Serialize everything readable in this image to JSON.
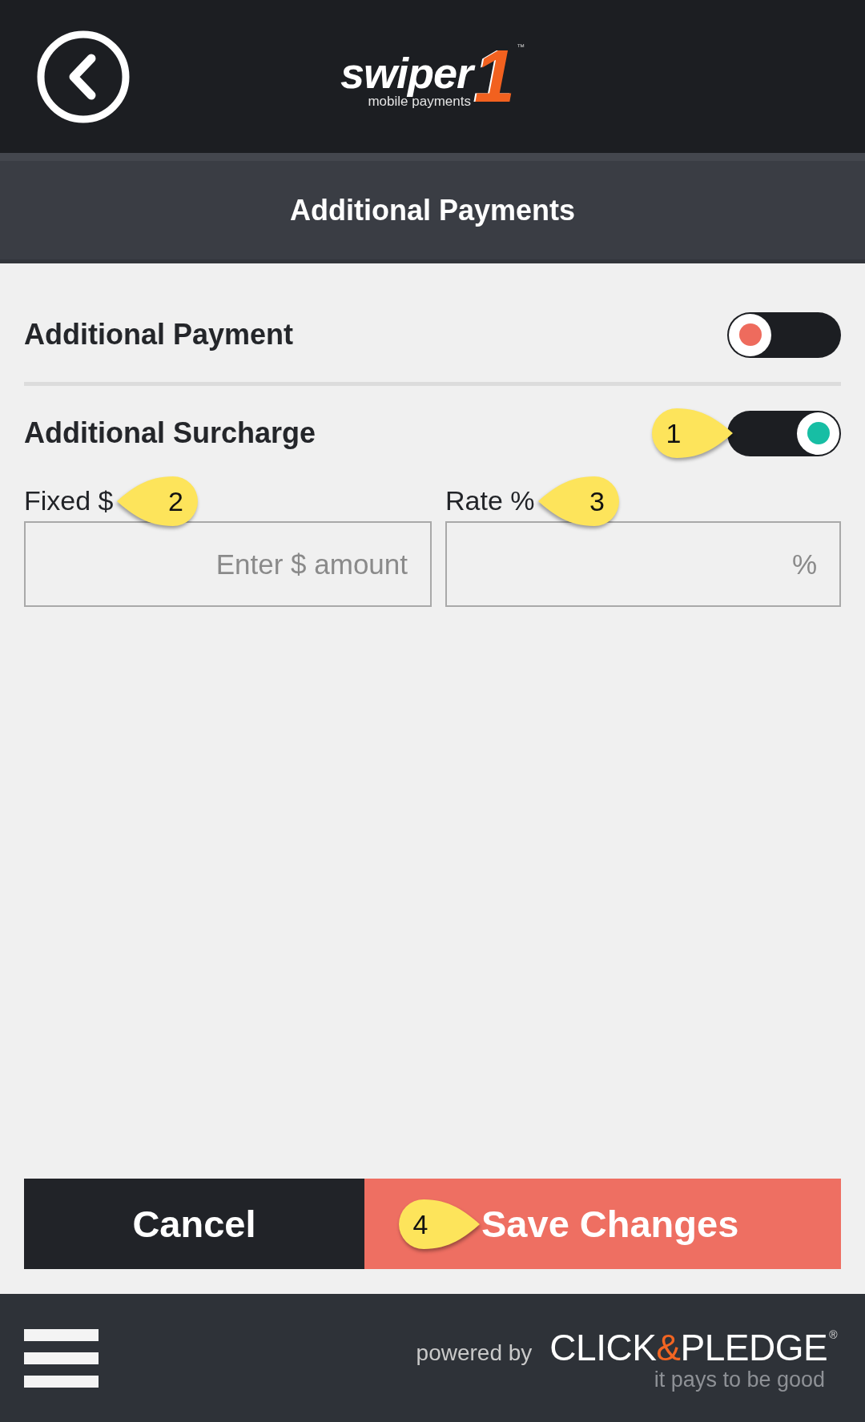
{
  "logo": {
    "wordmark": "swiper",
    "numeral": "1",
    "tagline": "mobile payments",
    "trademark": "™"
  },
  "title_bar": {
    "title": "Additional Payments"
  },
  "settings": [
    {
      "label": "Additional Payment",
      "on": false
    },
    {
      "label": "Additional Surcharge",
      "on": true,
      "callout": {
        "number": "1",
        "kind": "rightward"
      }
    }
  ],
  "fields": [
    {
      "label": "Fixed $",
      "placeholder": "Enter $ amount",
      "callout": {
        "number": "2",
        "kind": "leftward"
      }
    },
    {
      "label": "Rate %",
      "placeholder": "%",
      "callout": {
        "number": "3",
        "kind": "leftward"
      }
    }
  ],
  "buttons": [
    {
      "label": "Cancel",
      "kind": "secondary"
    },
    {
      "label": "Save Changes",
      "kind": "primary",
      "callout": {
        "number": "4",
        "kind": "rightward"
      }
    }
  ],
  "footer": {
    "powered_by": "powered by",
    "brand": [
      {
        "text": "CLICK",
        "accent": false
      },
      {
        "text": "&",
        "accent": true
      },
      {
        "text": "PLEDGE",
        "accent": false
      }
    ],
    "registered": "®",
    "slogan": "it pays to be good"
  }
}
